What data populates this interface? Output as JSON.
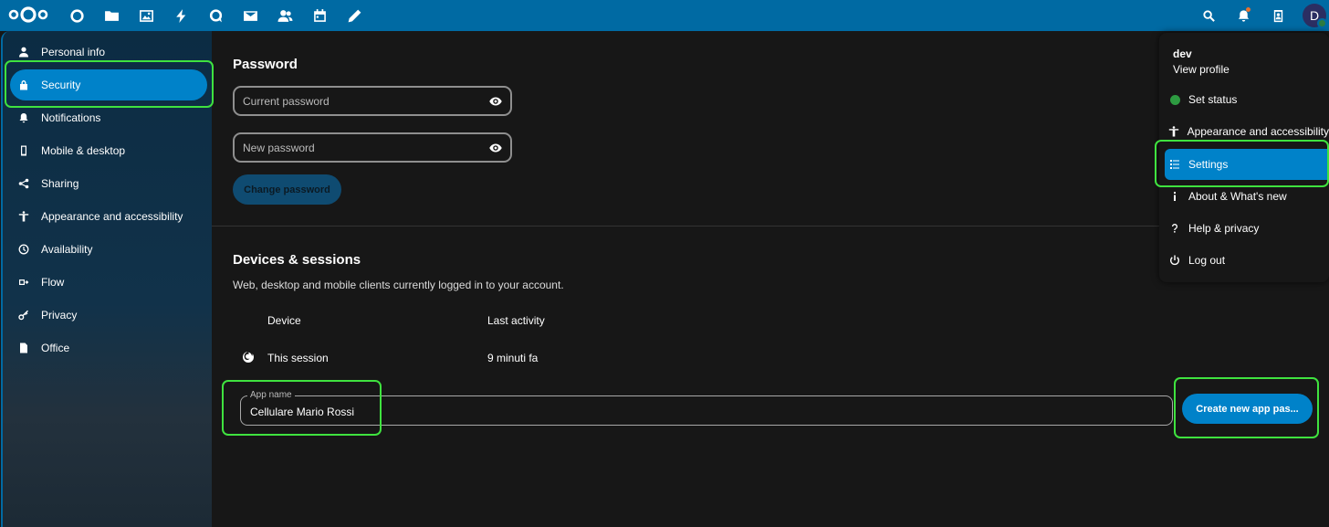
{
  "header": {
    "apps": [
      {
        "icon": "dashboard-icon"
      },
      {
        "icon": "files-icon"
      },
      {
        "icon": "photos-icon"
      },
      {
        "icon": "activity-icon"
      },
      {
        "icon": "talk-icon"
      },
      {
        "icon": "mail-icon"
      },
      {
        "icon": "contacts-icon"
      },
      {
        "icon": "calendar-icon"
      },
      {
        "icon": "notes-icon"
      }
    ],
    "avatar_initial": "D"
  },
  "sidebar": {
    "items": [
      {
        "label": "Personal info",
        "icon": "person-icon"
      },
      {
        "label": "Security",
        "icon": "lock-icon",
        "active": true
      },
      {
        "label": "Notifications",
        "icon": "bell-icon"
      },
      {
        "label": "Mobile & desktop",
        "icon": "phone-icon"
      },
      {
        "label": "Sharing",
        "icon": "share-icon"
      },
      {
        "label": "Appearance and accessibility",
        "icon": "accessibility-icon"
      },
      {
        "label": "Availability",
        "icon": "clock-icon"
      },
      {
        "label": "Flow",
        "icon": "flow-icon"
      },
      {
        "label": "Privacy",
        "icon": "key-icon"
      },
      {
        "label": "Office",
        "icon": "document-icon"
      }
    ]
  },
  "password": {
    "title": "Password",
    "current_placeholder": "Current password",
    "new_placeholder": "New password",
    "change_label": "Change password"
  },
  "devices": {
    "title": "Devices & sessions",
    "description": "Web, desktop and mobile clients currently logged in to your account.",
    "col_device": "Device",
    "col_activity": "Last activity",
    "rows": [
      {
        "device": "This session",
        "activity": "9 minuti fa"
      }
    ],
    "app_name_label": "App name",
    "app_name_value": "Cellulare Mario Rossi",
    "create_label": "Create new app pas..."
  },
  "user_menu": {
    "username": "dev",
    "view_profile": "View profile",
    "items": [
      {
        "label": "Set status",
        "icon": "status-dot"
      },
      {
        "label": "Appearance and accessibility",
        "icon": "accessibility-icon"
      },
      {
        "label": "Settings",
        "icon": "settings-list-icon",
        "active": true
      },
      {
        "label": "About & What's new",
        "icon": "info-icon"
      },
      {
        "label": "Help & privacy",
        "icon": "help-icon"
      },
      {
        "label": "Log out",
        "icon": "power-icon"
      }
    ]
  },
  "colors": {
    "header_bg": "#006aa3",
    "primary": "#0082c9",
    "highlight": "#3fe23f",
    "background": "#171717"
  }
}
